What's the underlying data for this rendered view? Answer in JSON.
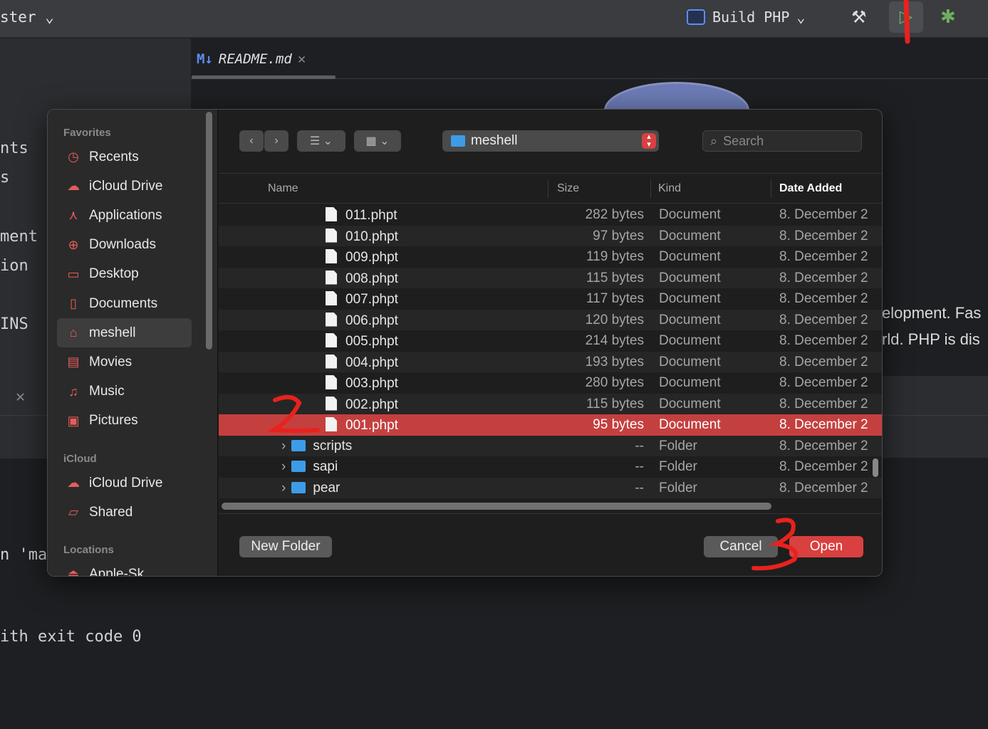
{
  "ide": {
    "branch": "ster",
    "run_config": "Build PHP",
    "tab": {
      "prefix": "M↓",
      "name": "README.md"
    },
    "bg_left_lines": [
      "nts",
      "s",
      "ment",
      "ion",
      "INS",
      "n 'ma",
      "ith exit code 0"
    ],
    "bg_right_lines": [
      "elopment. Fas",
      "rld. PHP is dis"
    ]
  },
  "dialog": {
    "sidebar": {
      "sections": [
        {
          "title": "Favorites",
          "items": [
            {
              "label": "Recents",
              "icon": "clock-icon"
            },
            {
              "label": "iCloud Drive",
              "icon": "cloud-icon"
            },
            {
              "label": "Applications",
              "icon": "applications-icon"
            },
            {
              "label": "Downloads",
              "icon": "download-icon"
            },
            {
              "label": "Desktop",
              "icon": "desktop-icon"
            },
            {
              "label": "Documents",
              "icon": "document-icon"
            },
            {
              "label": "meshell",
              "icon": "home-icon",
              "selected": true
            },
            {
              "label": "Movies",
              "icon": "film-icon"
            },
            {
              "label": "Music",
              "icon": "music-icon"
            },
            {
              "label": "Pictures",
              "icon": "photo-icon"
            }
          ]
        },
        {
          "title": "iCloud",
          "items": [
            {
              "label": "iCloud Drive",
              "icon": "cloud-icon"
            },
            {
              "label": "Shared",
              "icon": "shared-folder-icon"
            }
          ]
        },
        {
          "title": "Locations",
          "items": [
            {
              "label": "Apple-Sk",
              "icon": "disk-icon"
            }
          ]
        }
      ]
    },
    "path": "meshell",
    "search_placeholder": "Search",
    "columns": [
      "Name",
      "Size",
      "Kind",
      "Date Added"
    ],
    "rows": [
      {
        "name": "011.phpt",
        "size": "282 bytes",
        "kind": "Document",
        "date": "8. December 2"
      },
      {
        "name": "010.phpt",
        "size": "97 bytes",
        "kind": "Document",
        "date": "8. December 2"
      },
      {
        "name": "009.phpt",
        "size": "119 bytes",
        "kind": "Document",
        "date": "8. December 2"
      },
      {
        "name": "008.phpt",
        "size": "115 bytes",
        "kind": "Document",
        "date": "8. December 2"
      },
      {
        "name": "007.phpt",
        "size": "117 bytes",
        "kind": "Document",
        "date": "8. December 2"
      },
      {
        "name": "006.phpt",
        "size": "120 bytes",
        "kind": "Document",
        "date": "8. December 2"
      },
      {
        "name": "005.phpt",
        "size": "214 bytes",
        "kind": "Document",
        "date": "8. December 2"
      },
      {
        "name": "004.phpt",
        "size": "193 bytes",
        "kind": "Document",
        "date": "8. December 2"
      },
      {
        "name": "003.phpt",
        "size": "280 bytes",
        "kind": "Document",
        "date": "8. December 2"
      },
      {
        "name": "002.phpt",
        "size": "115 bytes",
        "kind": "Document",
        "date": "8. December 2"
      },
      {
        "name": "001.phpt",
        "size": "95 bytes",
        "kind": "Document",
        "date": "8. December 2",
        "selected": true
      },
      {
        "name": "scripts",
        "size": "--",
        "kind": "Folder",
        "date": "8. December 2",
        "folder": true
      },
      {
        "name": "sapi",
        "size": "--",
        "kind": "Folder",
        "date": "8. December 2",
        "folder": true
      },
      {
        "name": "pear",
        "size": "--",
        "kind": "Folder",
        "date": "8. December 2",
        "folder": true
      }
    ],
    "buttons": {
      "new_folder": "New Folder",
      "cancel": "Cancel",
      "open": "Open"
    }
  },
  "colors": {
    "accent": "#d9403f",
    "selected_row": "#c4403f",
    "annotation": "#e8221e"
  }
}
